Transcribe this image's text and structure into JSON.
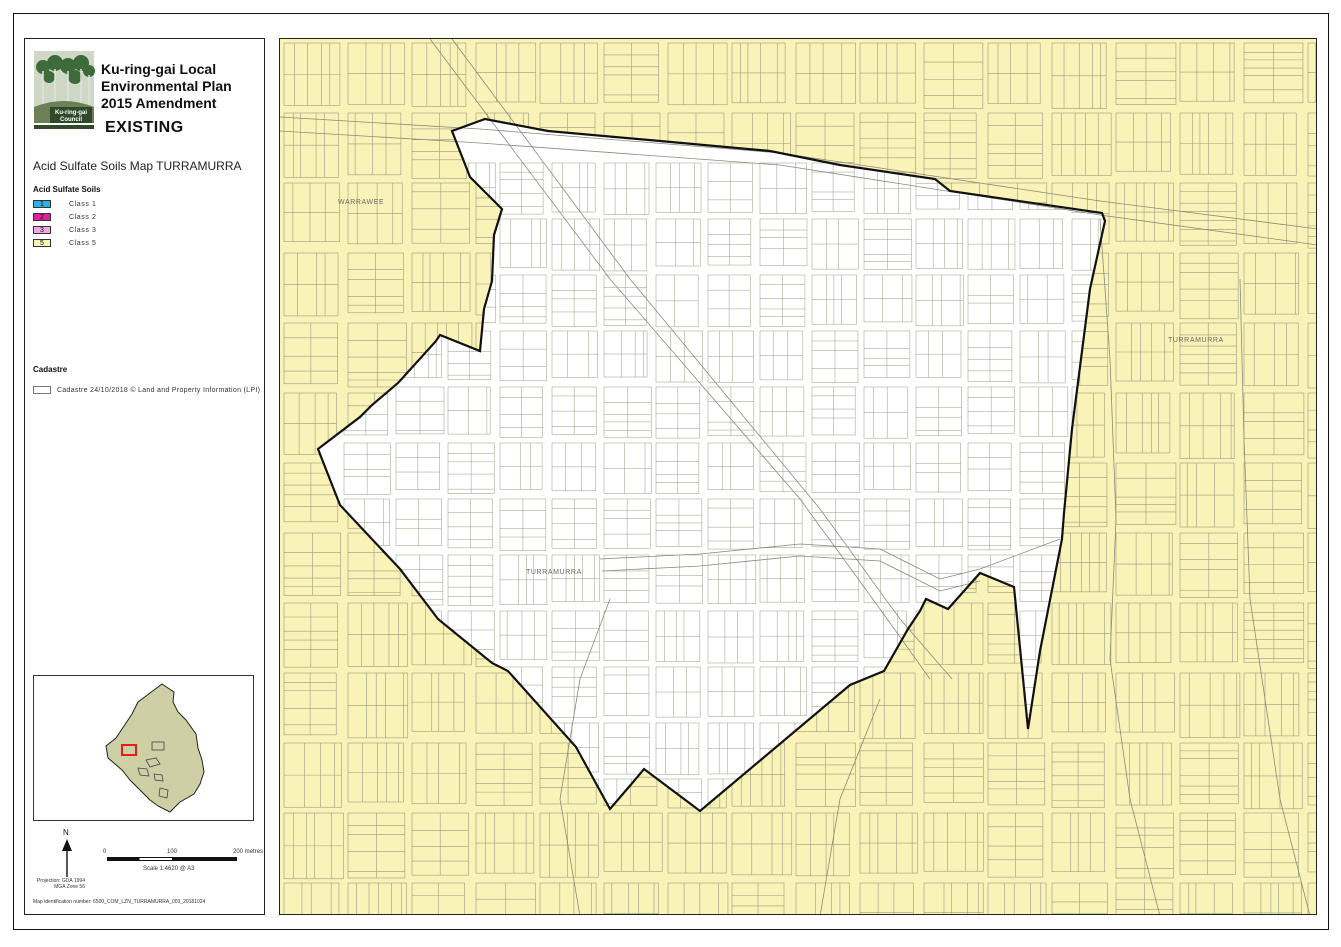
{
  "plan": {
    "council": "Ku-ring-gai Council",
    "title": "Ku-ring-gai Local Environmental Plan 2015 Amendment",
    "status": "EXISTING",
    "map_title": "Acid Sulfate Soils Map TURRAMURRA"
  },
  "legend": {
    "heading": "Acid Sulfate Soils",
    "items": [
      {
        "code": "1",
        "label": "Class 1",
        "color": "#2bb0e6"
      },
      {
        "code": "2",
        "label": "Class 2",
        "color": "#e0209c"
      },
      {
        "code": "3",
        "label": "Class 3",
        "color": "#f0a8e4"
      },
      {
        "code": "5",
        "label": "Class 5",
        "color": "#faf3b8"
      }
    ],
    "cadastre_heading": "Cadastre",
    "cadastre_label": "Cadastre 24/10/2018 © Land and Property Information (LPI)"
  },
  "scale": {
    "ticks": [
      "0",
      "100",
      "200 metres"
    ],
    "text": "Scale 1:4620 @ A3",
    "north": "N",
    "projection": "Projection: GDA 1994 MGA Zone 56"
  },
  "map_id": "Map identification number: 6500_COM_LZN_TURRAMURRA_003_20181024",
  "places": {
    "warrawee": "WARRAWEE",
    "turramurra_east": "TURRAMURRA",
    "turramurra_centre": "TURRAMURRA"
  },
  "colors": {
    "class5": "#faf3b8",
    "boundary": "#111111",
    "cadastre": "#8a8a7a"
  }
}
